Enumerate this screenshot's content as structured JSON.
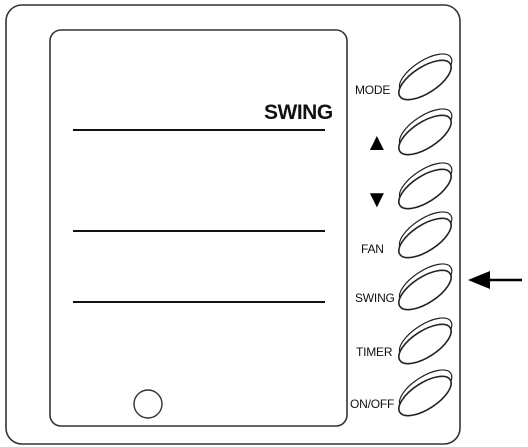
{
  "display": {
    "swing_indicator": "SWING"
  },
  "buttons": [
    {
      "id": "mode",
      "label": "MODE"
    },
    {
      "id": "up",
      "label": "▲"
    },
    {
      "id": "down",
      "label": "▼"
    },
    {
      "id": "fan",
      "label": "FAN"
    },
    {
      "id": "swing",
      "label": "SWING"
    },
    {
      "id": "timer",
      "label": "TIMER"
    },
    {
      "id": "on-off",
      "label": "ON/OFF"
    }
  ],
  "pointer": {
    "target": "swing",
    "icon": "left-arrow-icon"
  }
}
